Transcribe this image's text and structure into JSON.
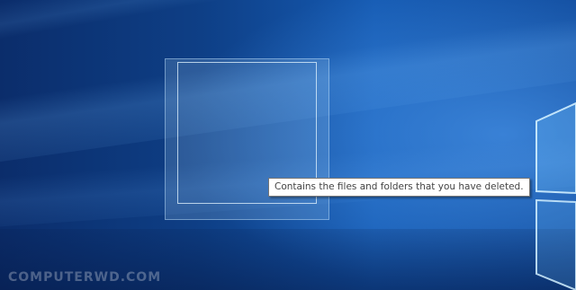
{
  "desktop": {
    "tooltip_text": "Contains the files and folders that you have deleted.",
    "watermark_text": "COMPUTERWD.COM"
  },
  "colors": {
    "wallpaper_dark": "#0b2d6b",
    "wallpaper_mid": "#155ab2",
    "tooltip_background": "#ffffff",
    "tooltip_border": "#767676",
    "tooltip_text": "#444444"
  },
  "icons": {
    "recycle_bin": "recycle-bin-icon",
    "windows_logo": "windows-logo-icon"
  }
}
